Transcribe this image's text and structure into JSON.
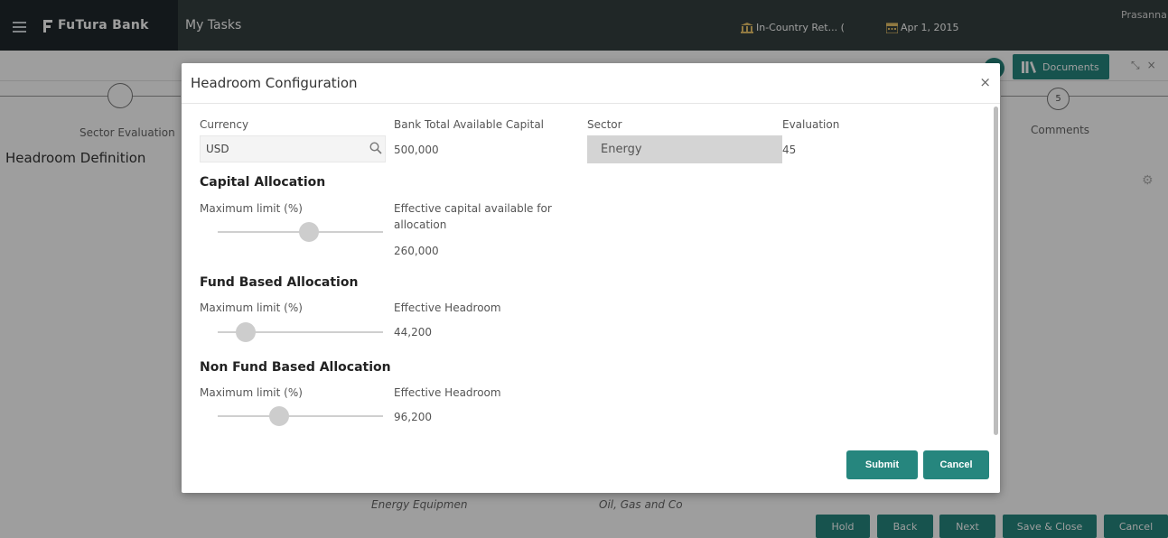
{
  "app": {
    "brand": "FuTura Bank",
    "page_title": "My Tasks",
    "branch": "In-Country Ret... (",
    "date": "Apr 1, 2015",
    "user": "Prasanna"
  },
  "workspace": {
    "documents_label": "Documents",
    "steps": [
      {
        "label": "Sector Evaluation"
      },
      {
        "number": "5",
        "label": "Comments"
      }
    ],
    "section_title": "Headroom Definition",
    "background_texts": [
      "Energy Equipmen",
      "Oil, Gas and Co"
    ],
    "footer_buttons": [
      "Hold",
      "Back",
      "Next",
      "Save & Close",
      "Cancel"
    ]
  },
  "modal": {
    "title": "Headroom Configuration",
    "fields": {
      "currency": {
        "label": "Currency",
        "value": "USD"
      },
      "bank_capital": {
        "label": "Bank Total Available Capital",
        "value": "500,000"
      },
      "sector": {
        "label": "Sector",
        "value": "Energy"
      },
      "evaluation": {
        "label": "Evaluation",
        "value": "45"
      }
    },
    "capital_allocation": {
      "title": "Capital Allocation",
      "slider_label": "Maximum limit (%)",
      "slider_fraction": 0.55,
      "effective_label_line1": "Effective capital available for",
      "effective_label_line2": "allocation",
      "effective_value": "260,000"
    },
    "fund_based": {
      "title": "Fund Based Allocation",
      "slider_label": "Maximum limit (%)",
      "slider_fraction": 0.17,
      "effective_label": "Effective Headroom",
      "effective_value": "44,200"
    },
    "non_fund_based": {
      "title": "Non Fund Based Allocation",
      "slider_label": "Maximum limit (%)",
      "slider_fraction": 0.37,
      "effective_label": "Effective Headroom",
      "effective_value": "96,200"
    },
    "submit_label": "Submit",
    "cancel_label": "Cancel"
  },
  "colors": {
    "accent": "#26867e",
    "brand_bg": "#20272c",
    "header_bg": "#35403f"
  }
}
